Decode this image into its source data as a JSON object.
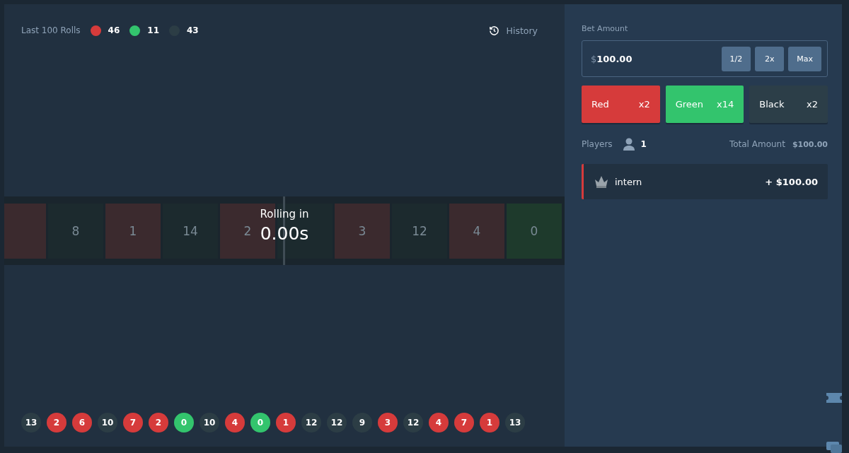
{
  "stats": {
    "label": "Last 100 Rolls",
    "counts": [
      {
        "color": "#d63b3b",
        "value": "46"
      },
      {
        "color": "#33c46d",
        "value": "11"
      },
      {
        "color": "#2c3d45",
        "value": "43"
      }
    ]
  },
  "history": {
    "label": "History"
  },
  "reel": {
    "tiles": [
      {
        "color": "#3b2a2e"
      },
      {
        "color": "#1c2a2e",
        "number": "8"
      },
      {
        "color": "#3b2a2e",
        "number": "1"
      },
      {
        "color": "#1c2a2e",
        "number": "14"
      },
      {
        "color": "#3b2a2e",
        "number": "2"
      },
      {
        "color": "#1c2a2e"
      },
      {
        "color": "#3b2a2e",
        "number": "3"
      },
      {
        "color": "#1c2a2e",
        "number": "12"
      },
      {
        "color": "#3b2a2e",
        "number": "4"
      },
      {
        "color": "#1e3a2c",
        "number": "0"
      }
    ],
    "title": "Rolling in",
    "timer": "0.00s"
  },
  "rolls": [
    {
      "number": "13",
      "color": "#2c3d45"
    },
    {
      "number": "2",
      "color": "#d63b3b"
    },
    {
      "number": "6",
      "color": "#d63b3b"
    },
    {
      "number": "10",
      "color": "#2c3d45"
    },
    {
      "number": "7",
      "color": "#d63b3b"
    },
    {
      "number": "2",
      "color": "#d63b3b"
    },
    {
      "number": "0",
      "color": "#33c46d"
    },
    {
      "number": "10",
      "color": "#2c3d45"
    },
    {
      "number": "4",
      "color": "#d63b3b"
    },
    {
      "number": "0",
      "color": "#33c46d"
    },
    {
      "number": "1",
      "color": "#d63b3b"
    },
    {
      "number": "12",
      "color": "#2c3d45"
    },
    {
      "number": "12",
      "color": "#2c3d45"
    },
    {
      "number": "9",
      "color": "#2c3d45"
    },
    {
      "number": "3",
      "color": "#d63b3b"
    },
    {
      "number": "12",
      "color": "#2c3d45"
    },
    {
      "number": "4",
      "color": "#d63b3b"
    },
    {
      "number": "7",
      "color": "#d63b3b"
    },
    {
      "number": "1",
      "color": "#d63b3b"
    },
    {
      "number": "13",
      "color": "#2c3d45"
    }
  ],
  "bet": {
    "label": "Bet Amount",
    "currency": "$",
    "value": "100.00",
    "buttons": [
      "1/2",
      "2x",
      "Max"
    ]
  },
  "choices": [
    {
      "label": "Red",
      "payout": "x2",
      "color": "#d63b3b"
    },
    {
      "label": "Green",
      "payout": "x14",
      "color": "#33c46d"
    },
    {
      "label": "Black",
      "payout": "x2",
      "color": "#2c3e48"
    }
  ],
  "players": {
    "label": "Players",
    "count": "1",
    "total_label": "Total Amount",
    "total": "$100.00"
  },
  "bets": [
    {
      "name": "intern",
      "amount": "+ $100.00",
      "color": "#d63b3b"
    }
  ]
}
